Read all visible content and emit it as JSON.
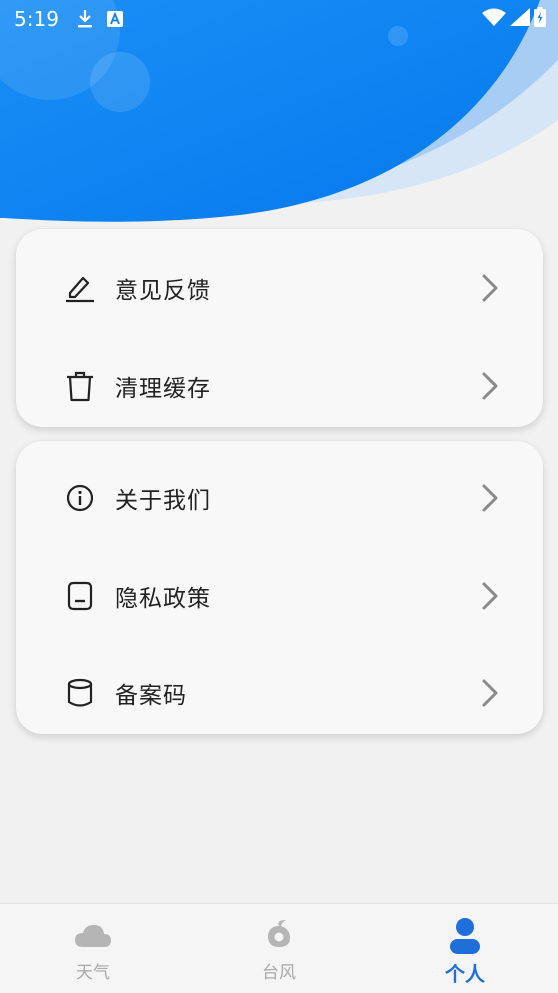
{
  "status_bar": {
    "time": "5:19",
    "icons": [
      "download-icon",
      "keyboard-a-icon",
      "wifi-icon",
      "signal-icon",
      "battery-icon"
    ]
  },
  "colors": {
    "header_blue": "#0a83f0",
    "accent": "#1e6fd9",
    "inactive": "#a9a9a9"
  },
  "menu": {
    "group1": [
      {
        "label": "意见反馈",
        "icon": "edit-icon"
      },
      {
        "label": "清理缓存",
        "icon": "trash-icon"
      }
    ],
    "group2": [
      {
        "label": "关于我们",
        "icon": "info-icon"
      },
      {
        "label": "隐私政策",
        "icon": "document-icon"
      },
      {
        "label": "备案码",
        "icon": "cylinder-icon"
      }
    ]
  },
  "tabbar": {
    "tabs": [
      {
        "label": "天气",
        "icon": "cloud-icon",
        "active": false
      },
      {
        "label": "台风",
        "icon": "typhoon-icon",
        "active": false
      },
      {
        "label": "个人",
        "icon": "person-icon",
        "active": true
      }
    ]
  }
}
